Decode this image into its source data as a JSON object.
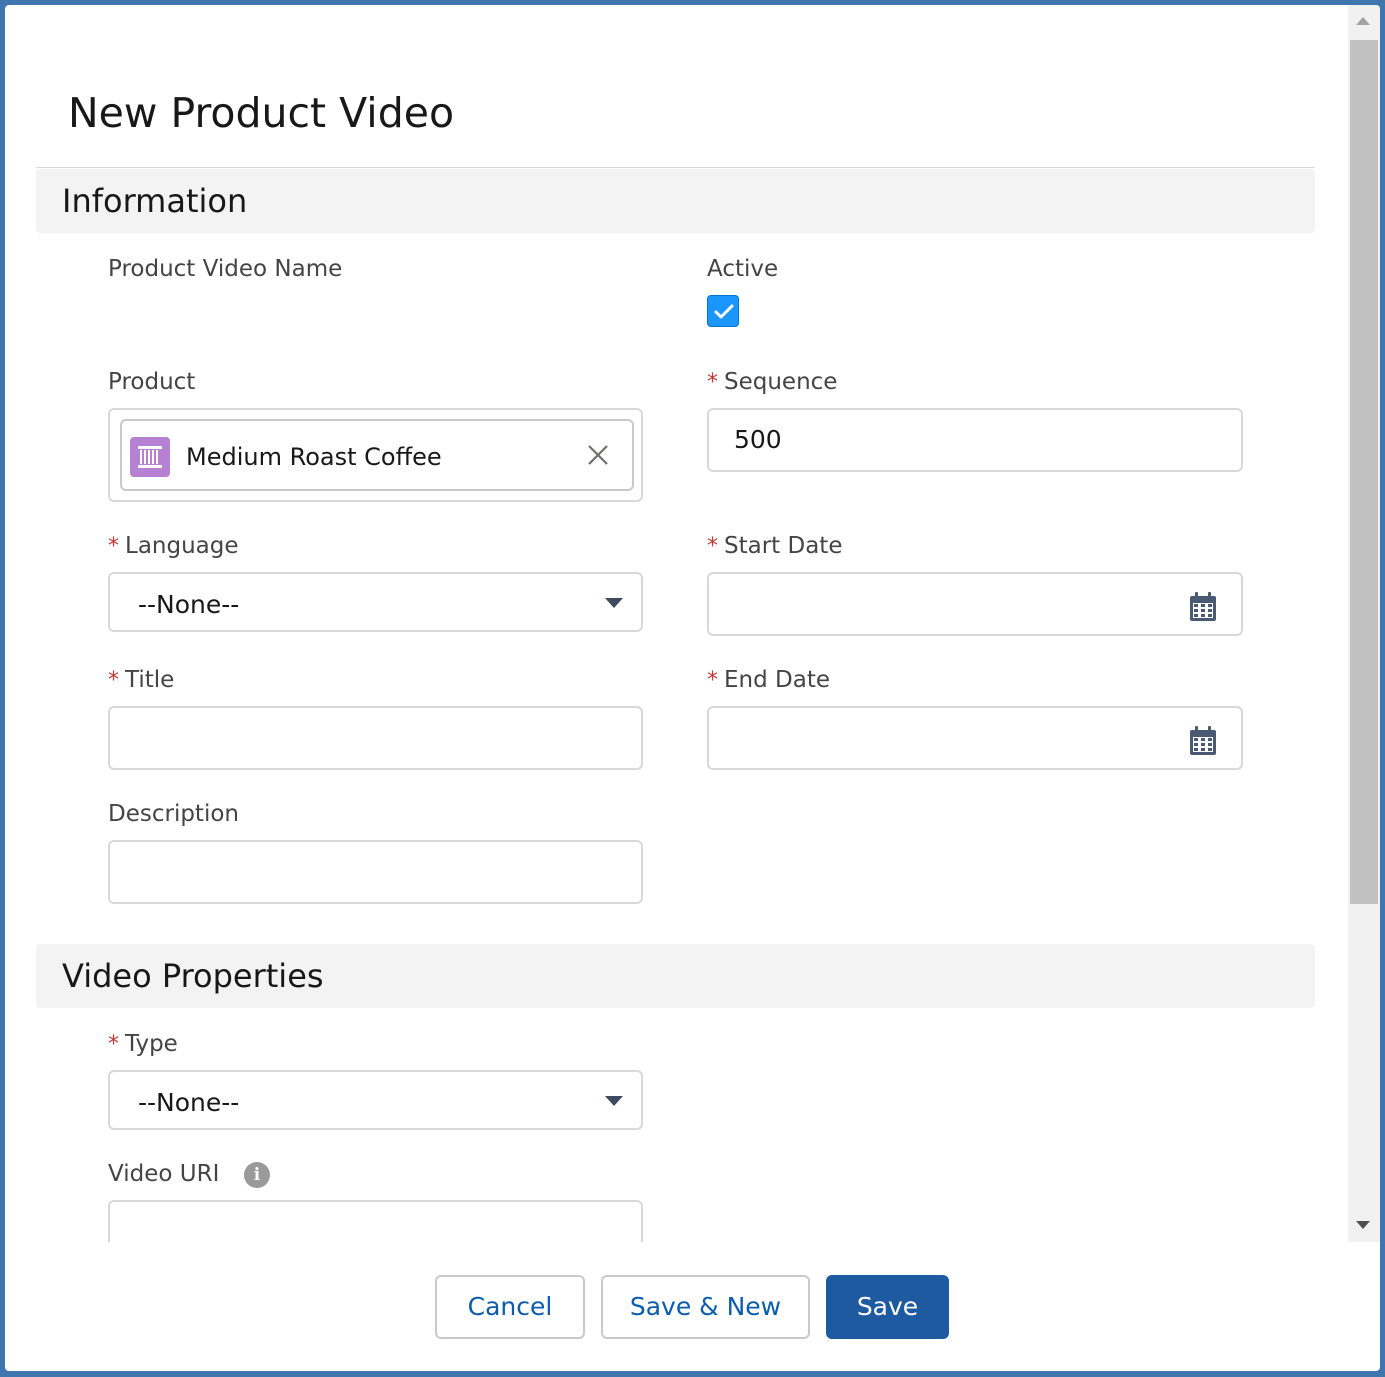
{
  "modal": {
    "title": "New Product Video"
  },
  "sections": {
    "information": "Information",
    "video_properties": "Video Properties"
  },
  "fields": {
    "product_video_name": {
      "label": "Product Video Name"
    },
    "active": {
      "label": "Active",
      "checked": true
    },
    "product": {
      "label": "Product",
      "value": "Medium Roast Coffee"
    },
    "sequence": {
      "label": "Sequence",
      "required": "*",
      "value": "500"
    },
    "language": {
      "label": "Language",
      "required": "*",
      "value": "--None--"
    },
    "start_date": {
      "label": "Start Date",
      "required": "*",
      "value": ""
    },
    "title": {
      "label": "Title",
      "required": "*",
      "value": ""
    },
    "end_date": {
      "label": "End Date",
      "required": "*",
      "value": ""
    },
    "description": {
      "label": "Description",
      "value": ""
    },
    "type": {
      "label": "Type",
      "required": "*",
      "value": "--None--"
    },
    "video_uri": {
      "label": "Video URI",
      "value": "",
      "info_icon": "i"
    }
  },
  "footer": {
    "cancel": "Cancel",
    "save_new": "Save & New",
    "save": "Save"
  },
  "colors": {
    "brand": "#1d5aa0",
    "checkbox": "#1b96ff",
    "required": "#c23934",
    "product_icon": "#b781d3"
  },
  "icons": {
    "checkbox": "check-icon",
    "product": "product-icon",
    "clear": "close-icon",
    "calendar": "calendar-icon",
    "select": "chevron-down-icon",
    "info": "info-icon"
  }
}
